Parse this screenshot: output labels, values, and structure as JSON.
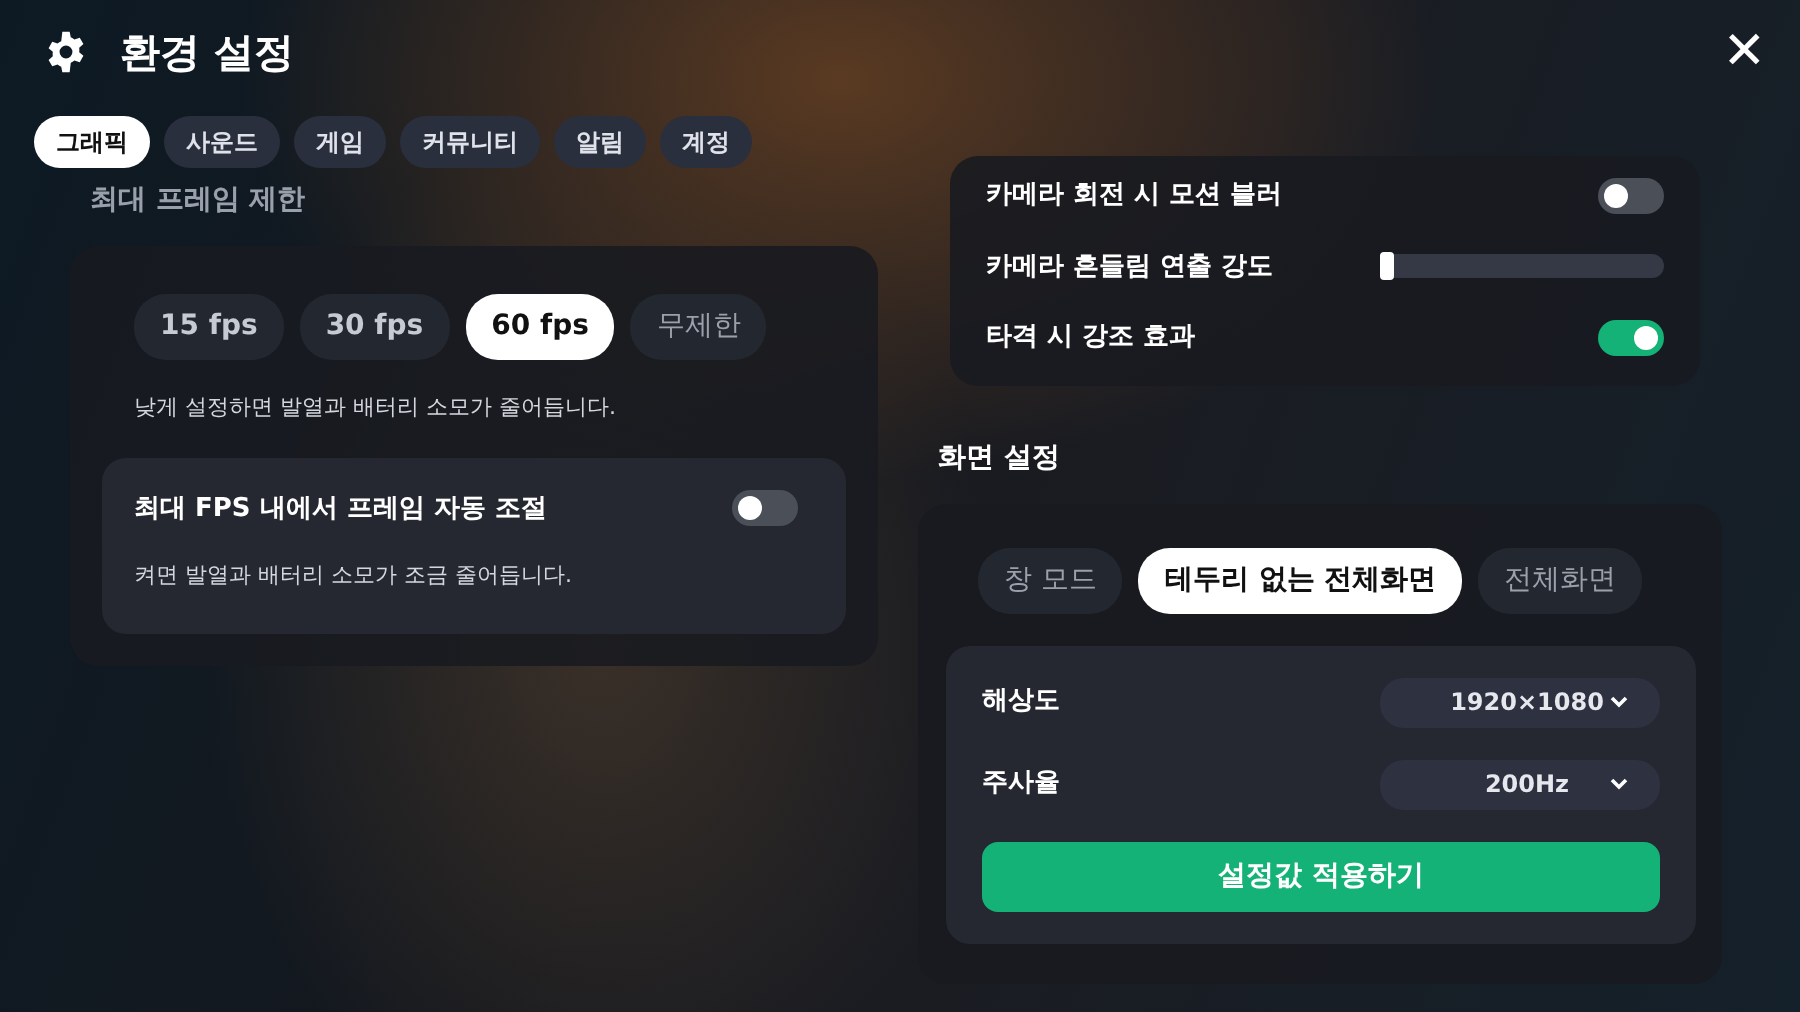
{
  "window": {
    "title": "환경 설정",
    "close": "✕"
  },
  "tabs": [
    {
      "label": "그래픽",
      "selected": true
    },
    {
      "label": "사운드",
      "selected": false
    },
    {
      "label": "게임",
      "selected": false
    },
    {
      "label": "커뮤니티",
      "selected": false
    },
    {
      "label": "알림",
      "selected": false
    },
    {
      "label": "계정",
      "selected": false
    }
  ],
  "frame_limit": {
    "title": "최대 프레임 제한",
    "options": [
      {
        "label": "15 fps",
        "selected": false
      },
      {
        "label": "30 fps",
        "selected": false
      },
      {
        "label": "60 fps",
        "selected": true
      },
      {
        "label": "무제한",
        "selected": false
      }
    ],
    "note": "낮게 설정하면 발열과 배터리 소모가 줄어듭니다.",
    "auto_adjust": {
      "label": "최대 FPS 내에서 프레임 자동 조절",
      "on": false,
      "note": "켜면 발열과 배터리 소모가 조금 줄어듭니다."
    }
  },
  "camera": {
    "rows": [
      {
        "kind": "toggle",
        "label": "카메라 회전 시 모션 블러",
        "on": false
      },
      {
        "kind": "slider",
        "label": "카메라 흔들림 연출 강도",
        "level": 0
      },
      {
        "kind": "toggle",
        "label": "타격 시 강조 효과",
        "on": true
      }
    ]
  },
  "display": {
    "title": "화면 설정",
    "modes": [
      {
        "label": "창 모드",
        "selected": false
      },
      {
        "label": "테두리 없는 전체화면",
        "selected": true
      },
      {
        "label": "전체화면",
        "selected": false
      }
    ],
    "selects": [
      {
        "label": "해상도",
        "value": "1920×1080"
      },
      {
        "label": "주사율",
        "value": "200Hz"
      }
    ],
    "apply_button": "설정값 적용하기"
  }
}
